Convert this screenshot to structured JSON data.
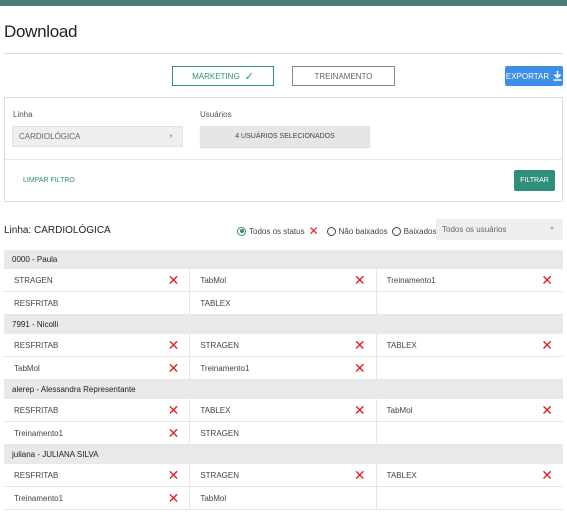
{
  "page": {
    "title": "Download"
  },
  "tabs": {
    "marketing_label": "MARKETING",
    "treinamento_label": "TREINAMENTO"
  },
  "export": {
    "label": "EXPORTAR"
  },
  "filter": {
    "linha_label": "Linha",
    "linha_value": "CARDIOLÓGICA",
    "usuarios_label": "Usuários",
    "usuarios_button": "4 USUÁRIOS SELECIONADOS",
    "clear_label": "LIMPAR FILTRO",
    "filter_button": "FILTRAR"
  },
  "results": {
    "heading": "Linha: CARDIOLÓGICA",
    "status_all": "Todos os status",
    "status_not_downloaded": "Não baixados",
    "status_downloaded": "Baixados",
    "users_select": "Todos os usuários"
  },
  "groups": [
    {
      "name": "0000 - Paula",
      "rows": [
        [
          {
            "label": "STRAGEN",
            "x": true
          },
          {
            "label": "TabMol",
            "x": true
          },
          {
            "label": "Treinamento1",
            "x": true
          }
        ],
        [
          {
            "label": "RESFRITAB",
            "x": false
          },
          {
            "label": "TABLEX",
            "x": false
          },
          null
        ]
      ]
    },
    {
      "name": "7991 - Nicolli",
      "rows": [
        [
          {
            "label": "RESFRITAB",
            "x": true
          },
          {
            "label": "STRAGEN",
            "x": true
          },
          {
            "label": "TABLEX",
            "x": true
          }
        ],
        [
          {
            "label": "TabMol",
            "x": true
          },
          {
            "label": "Treinamento1",
            "x": true
          },
          null
        ]
      ]
    },
    {
      "name": "alerep - Alessandra Representante",
      "rows": [
        [
          {
            "label": "RESFRITAB",
            "x": true
          },
          {
            "label": "TABLEX",
            "x": true
          },
          {
            "label": "TabMol",
            "x": true
          }
        ],
        [
          {
            "label": "Treinamento1",
            "x": true
          },
          {
            "label": "STRAGEN",
            "x": false
          },
          null
        ]
      ]
    },
    {
      "name": "juliana - JULIANA SILVA",
      "rows": [
        [
          {
            "label": "RESFRITAB",
            "x": true
          },
          {
            "label": "STRAGEN",
            "x": true
          },
          {
            "label": "TABLEX",
            "x": true
          }
        ],
        [
          {
            "label": "Treinamento1",
            "x": true
          },
          {
            "label": "TabMol",
            "x": false
          },
          null
        ]
      ]
    }
  ],
  "colors": {
    "accent": "#2f8f7a",
    "export_blue": "#3d8fe6",
    "x_red": "#e02020",
    "topbar": "#4a7c7a"
  }
}
